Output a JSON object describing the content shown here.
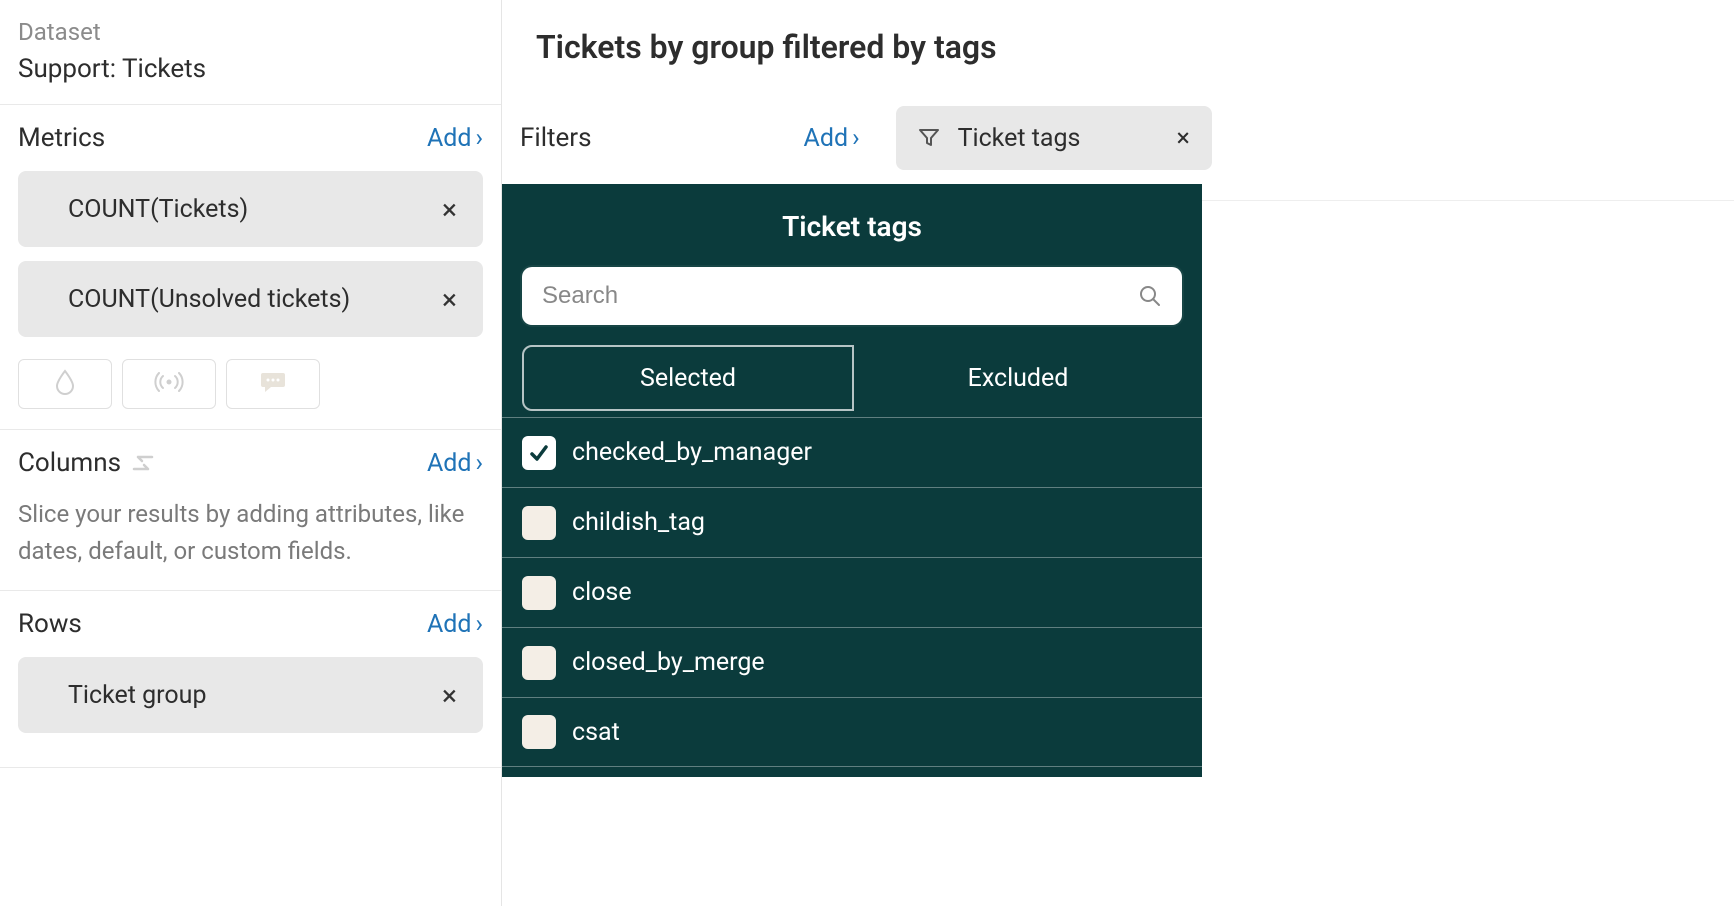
{
  "sidebar": {
    "dataset_label": "Dataset",
    "dataset_value": "Support: Tickets",
    "metrics": {
      "title": "Metrics",
      "add": "Add",
      "items": [
        {
          "label": "COUNT(Tickets)"
        },
        {
          "label": "COUNT(Unsolved tickets)"
        }
      ]
    },
    "columns": {
      "title": "Columns",
      "add": "Add",
      "hint": "Slice your results by adding attributes, like dates, default, or custom fields."
    },
    "rows": {
      "title": "Rows",
      "add": "Add",
      "items": [
        {
          "label": "Ticket group"
        }
      ]
    }
  },
  "main": {
    "title": "Tickets by group filtered by tags",
    "filters_label": "Filters",
    "filters_add": "Add",
    "filter_chip": {
      "label": "Ticket tags"
    }
  },
  "popover": {
    "title": "Ticket tags",
    "search_placeholder": "Search",
    "tab_selected": "Selected",
    "tab_excluded": "Excluded",
    "tags": [
      {
        "label": "checked_by_manager",
        "checked": true
      },
      {
        "label": "childish_tag",
        "checked": false
      },
      {
        "label": "close",
        "checked": false
      },
      {
        "label": "closed_by_merge",
        "checked": false
      },
      {
        "label": "csat",
        "checked": false
      }
    ]
  }
}
